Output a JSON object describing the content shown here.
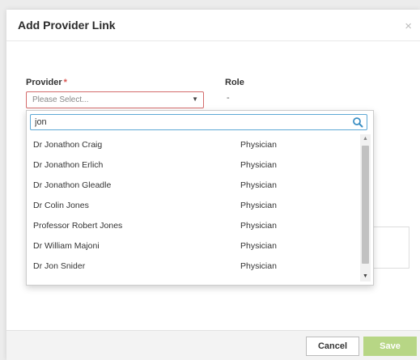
{
  "modal": {
    "title": "Add Provider Link",
    "close_glyph": "×"
  },
  "form": {
    "provider_label": "Provider",
    "required_mark": "*",
    "provider_placeholder": "Please Select...",
    "role_label": "Role",
    "role_value": "-"
  },
  "dropdown": {
    "search_value": "jon",
    "options": [
      {
        "name": "Dr Jonathon Craig",
        "role": "Physician"
      },
      {
        "name": "Dr Jonathon Erlich",
        "role": "Physician"
      },
      {
        "name": "Dr Jonathon Gleadle",
        "role": "Physician"
      },
      {
        "name": "Dr Colin Jones",
        "role": "Physician"
      },
      {
        "name": "Professor Robert Jones",
        "role": "Physician"
      },
      {
        "name": "Dr William Majoni",
        "role": "Physician"
      },
      {
        "name": "Dr Jon Snider",
        "role": "Physician"
      }
    ]
  },
  "footer": {
    "cancel_label": "Cancel",
    "save_label": "Save"
  },
  "colors": {
    "save_button": "#b7d685",
    "required": "#d9534f",
    "search_border": "#5da8d5",
    "invalid_border": "#d46b6b"
  },
  "icons": [
    "close-icon",
    "caret-down-icon",
    "search-icon",
    "scroll-up-icon",
    "scroll-down-icon"
  ]
}
